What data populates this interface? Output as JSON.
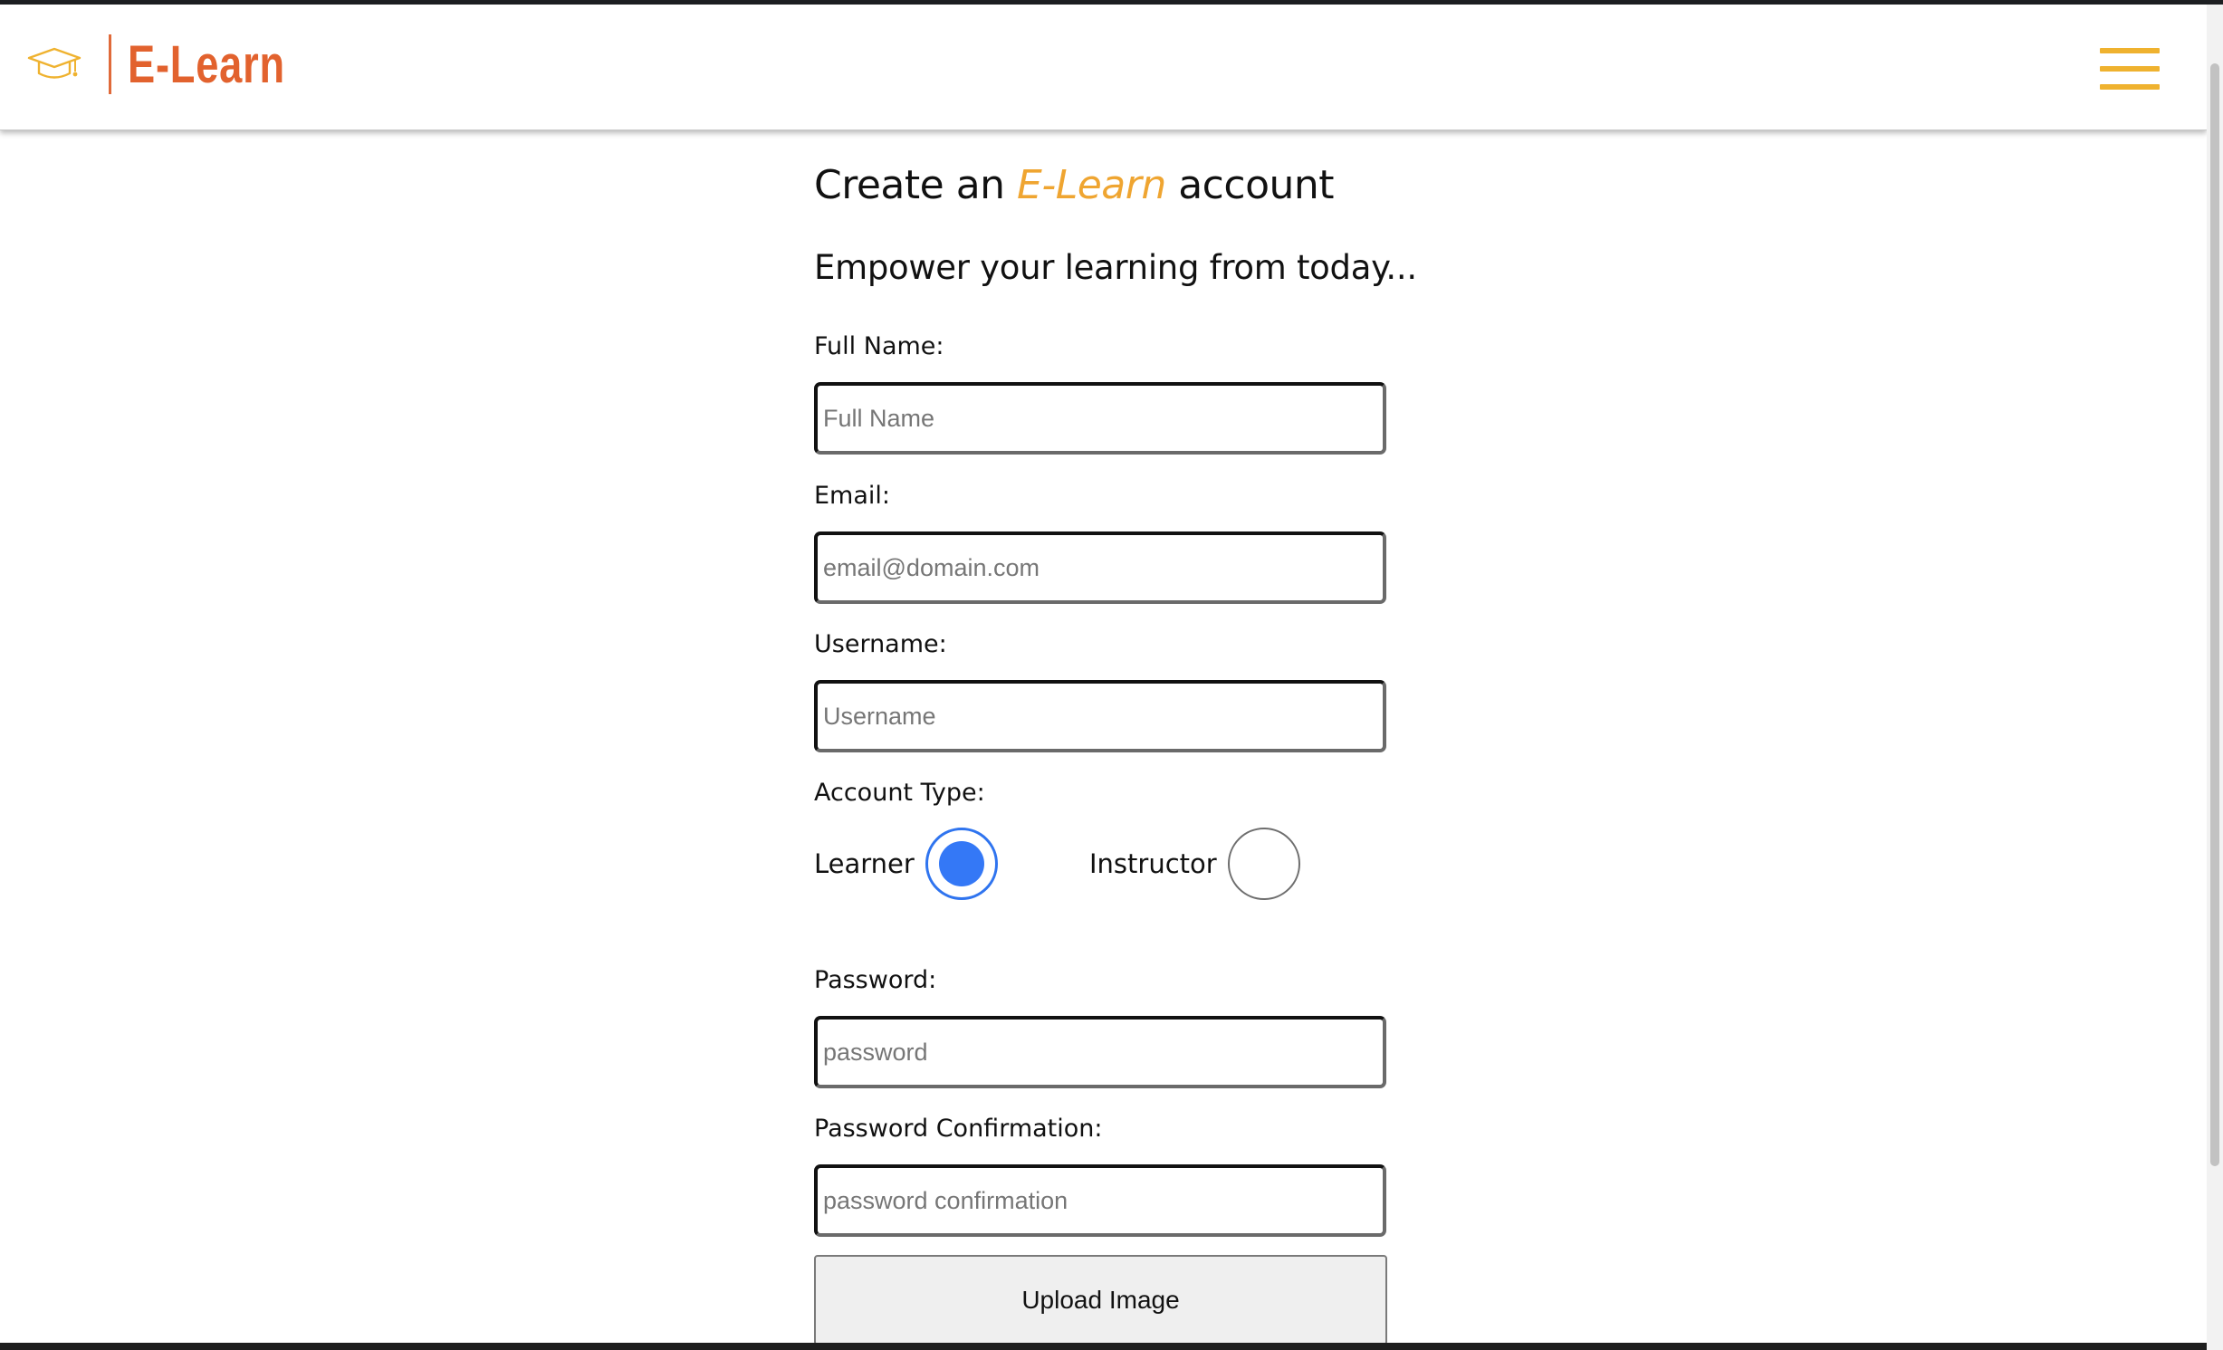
{
  "navbar": {
    "brand_name": "E-Learn",
    "brand_icon": "graduation-cap-icon",
    "menu_icon": "hamburger-menu-icon",
    "accent_color": "#efb22f",
    "brand_color": "#e2622e"
  },
  "form": {
    "title_before": "Create an ",
    "title_brand": "E-Learn",
    "title_after": " account",
    "tagline": "Empower your learning from today...",
    "full_name": {
      "label": "Full Name:",
      "placeholder": "Full Name",
      "value": ""
    },
    "email": {
      "label": "Email:",
      "placeholder": "email@domain.com",
      "value": ""
    },
    "username": {
      "label": "Username:",
      "placeholder": "Username",
      "value": ""
    },
    "account_type": {
      "label": "Account Type:",
      "options": [
        {
          "label": "Learner",
          "selected": true
        },
        {
          "label": "Instructor",
          "selected": false
        }
      ],
      "selected_color": "#3478f6"
    },
    "password": {
      "label": "Password:",
      "placeholder": "password",
      "value": ""
    },
    "password_confirmation": {
      "label": "Password Confirmation:",
      "placeholder": "password confirmation",
      "value": ""
    },
    "upload_button_label": "Upload Image"
  }
}
